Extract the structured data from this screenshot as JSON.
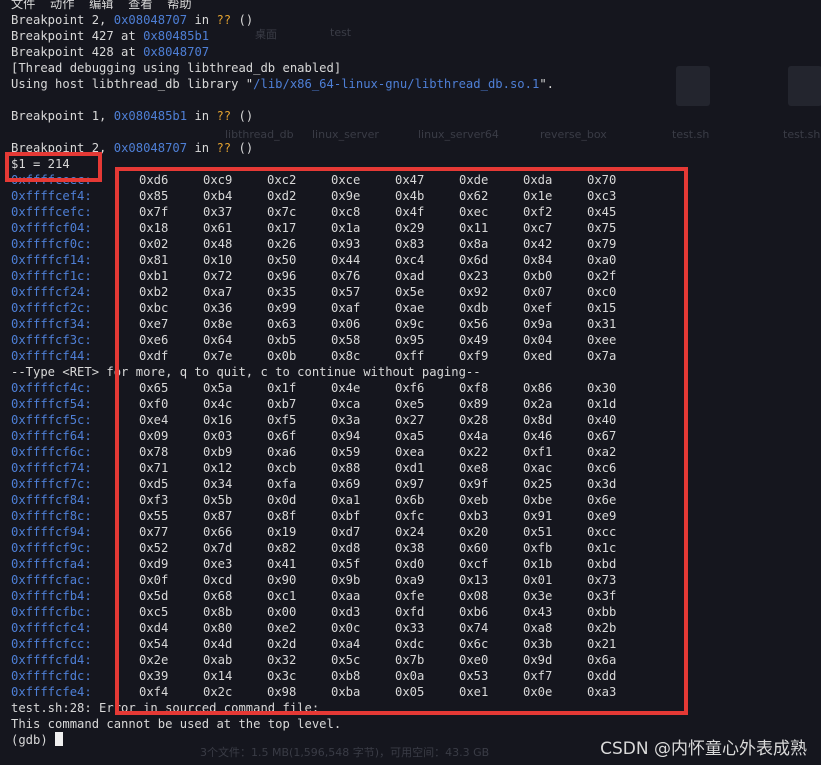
{
  "colors": {
    "background": "#15161e",
    "address": "#4e7fd6",
    "question": "#e0a030",
    "highlight_box": "#e53935"
  },
  "menu_fragment": "文件  动作  编辑  查看  帮助",
  "background_ghost": {
    "folders": [
      "linux_server",
      "linux_server64",
      "reverse_box",
      "test.sh",
      "test.sh"
    ],
    "labels": [
      "桌面",
      "test",
      "libthread_db"
    ],
    "status": "3个文件：1.5 MB(1,596,548 字节)，可用空间：43.3 GB"
  },
  "header_lines": [
    {
      "pre": "Breakpoint 2, ",
      "addr": "0x08048707",
      "mid": " in ",
      "q": "??",
      "post": " ()"
    },
    {
      "pre": "Breakpoint 427 at ",
      "addr": "0x80485b1",
      "mid": "",
      "q": "",
      "post": ""
    },
    {
      "pre": "Breakpoint 428 at ",
      "addr": "0x8048707",
      "mid": "",
      "q": "",
      "post": ""
    },
    {
      "pre": "[Thread debugging using libthread_db enabled]",
      "addr": "",
      "mid": "",
      "q": "",
      "post": ""
    },
    {
      "pre": "Using host libthread_db library \"",
      "addr": "/lib/x86_64-linux-gnu/libthread_db.so.1",
      "mid": "\".",
      "q": "",
      "post": ""
    },
    {
      "pre": "",
      "addr": "",
      "mid": "",
      "q": "",
      "post": ""
    },
    {
      "pre": "Breakpoint 1, ",
      "addr": "0x080485b1",
      "mid": " in ",
      "q": "??",
      "post": " ()"
    },
    {
      "pre": "",
      "addr": "",
      "mid": "",
      "q": "",
      "post": ""
    },
    {
      "pre": "Breakpoint 2, ",
      "addr": "0x08048707",
      "mid": " in ",
      "q": "??",
      "post": " ()"
    }
  ],
  "print_result": "$1 = 214",
  "mem_block1": [
    {
      "addr": "0xffffceec:",
      "bytes": [
        "0xd6",
        "0xc9",
        "0xc2",
        "0xce",
        "0x47",
        "0xde",
        "0xda",
        "0x70"
      ]
    },
    {
      "addr": "0xffffcef4:",
      "bytes": [
        "0x85",
        "0xb4",
        "0xd2",
        "0x9e",
        "0x4b",
        "0x62",
        "0x1e",
        "0xc3"
      ]
    },
    {
      "addr": "0xffffcefc:",
      "bytes": [
        "0x7f",
        "0x37",
        "0x7c",
        "0xc8",
        "0x4f",
        "0xec",
        "0xf2",
        "0x45"
      ]
    },
    {
      "addr": "0xffffcf04:",
      "bytes": [
        "0x18",
        "0x61",
        "0x17",
        "0x1a",
        "0x29",
        "0x11",
        "0xc7",
        "0x75"
      ]
    },
    {
      "addr": "0xffffcf0c:",
      "bytes": [
        "0x02",
        "0x48",
        "0x26",
        "0x93",
        "0x83",
        "0x8a",
        "0x42",
        "0x79"
      ]
    },
    {
      "addr": "0xffffcf14:",
      "bytes": [
        "0x81",
        "0x10",
        "0x50",
        "0x44",
        "0xc4",
        "0x6d",
        "0x84",
        "0xa0"
      ]
    },
    {
      "addr": "0xffffcf1c:",
      "bytes": [
        "0xb1",
        "0x72",
        "0x96",
        "0x76",
        "0xad",
        "0x23",
        "0xb0",
        "0x2f"
      ]
    },
    {
      "addr": "0xffffcf24:",
      "bytes": [
        "0xb2",
        "0xa7",
        "0x35",
        "0x57",
        "0x5e",
        "0x92",
        "0x07",
        "0xc0"
      ]
    },
    {
      "addr": "0xffffcf2c:",
      "bytes": [
        "0xbc",
        "0x36",
        "0x99",
        "0xaf",
        "0xae",
        "0xdb",
        "0xef",
        "0x15"
      ]
    },
    {
      "addr": "0xffffcf34:",
      "bytes": [
        "0xe7",
        "0x8e",
        "0x63",
        "0x06",
        "0x9c",
        "0x56",
        "0x9a",
        "0x31"
      ]
    },
    {
      "addr": "0xffffcf3c:",
      "bytes": [
        "0xe6",
        "0x64",
        "0xb5",
        "0x58",
        "0x95",
        "0x49",
        "0x04",
        "0xee"
      ]
    },
    {
      "addr": "0xffffcf44:",
      "bytes": [
        "0xdf",
        "0x7e",
        "0x0b",
        "0x8c",
        "0xff",
        "0xf9",
        "0xed",
        "0x7a"
      ]
    }
  ],
  "paging_prompt": "--Type <RET> for more, q to quit, c to continue without paging--",
  "mem_block2": [
    {
      "addr": "0xffffcf4c:",
      "bytes": [
        "0x65",
        "0x5a",
        "0x1f",
        "0x4e",
        "0xf6",
        "0xf8",
        "0x86",
        "0x30"
      ]
    },
    {
      "addr": "0xffffcf54:",
      "bytes": [
        "0xf0",
        "0x4c",
        "0xb7",
        "0xca",
        "0xe5",
        "0x89",
        "0x2a",
        "0x1d"
      ]
    },
    {
      "addr": "0xffffcf5c:",
      "bytes": [
        "0xe4",
        "0x16",
        "0xf5",
        "0x3a",
        "0x27",
        "0x28",
        "0x8d",
        "0x40"
      ]
    },
    {
      "addr": "0xffffcf64:",
      "bytes": [
        "0x09",
        "0x03",
        "0x6f",
        "0x94",
        "0xa5",
        "0x4a",
        "0x46",
        "0x67"
      ]
    },
    {
      "addr": "0xffffcf6c:",
      "bytes": [
        "0x78",
        "0xb9",
        "0xa6",
        "0x59",
        "0xea",
        "0x22",
        "0xf1",
        "0xa2"
      ]
    },
    {
      "addr": "0xffffcf74:",
      "bytes": [
        "0x71",
        "0x12",
        "0xcb",
        "0x88",
        "0xd1",
        "0xe8",
        "0xac",
        "0xc6"
      ]
    },
    {
      "addr": "0xffffcf7c:",
      "bytes": [
        "0xd5",
        "0x34",
        "0xfa",
        "0x69",
        "0x97",
        "0x9f",
        "0x25",
        "0x3d"
      ]
    },
    {
      "addr": "0xffffcf84:",
      "bytes": [
        "0xf3",
        "0x5b",
        "0x0d",
        "0xa1",
        "0x6b",
        "0xeb",
        "0xbe",
        "0x6e"
      ]
    },
    {
      "addr": "0xffffcf8c:",
      "bytes": [
        "0x55",
        "0x87",
        "0x8f",
        "0xbf",
        "0xfc",
        "0xb3",
        "0x91",
        "0xe9"
      ]
    },
    {
      "addr": "0xffffcf94:",
      "bytes": [
        "0x77",
        "0x66",
        "0x19",
        "0xd7",
        "0x24",
        "0x20",
        "0x51",
        "0xcc"
      ]
    },
    {
      "addr": "0xffffcf9c:",
      "bytes": [
        "0x52",
        "0x7d",
        "0x82",
        "0xd8",
        "0x38",
        "0x60",
        "0xfb",
        "0x1c"
      ]
    },
    {
      "addr": "0xffffcfa4:",
      "bytes": [
        "0xd9",
        "0xe3",
        "0x41",
        "0x5f",
        "0xd0",
        "0xcf",
        "0x1b",
        "0xbd"
      ]
    },
    {
      "addr": "0xffffcfac:",
      "bytes": [
        "0x0f",
        "0xcd",
        "0x90",
        "0x9b",
        "0xa9",
        "0x13",
        "0x01",
        "0x73"
      ]
    },
    {
      "addr": "0xffffcfb4:",
      "bytes": [
        "0x5d",
        "0x68",
        "0xc1",
        "0xaa",
        "0xfe",
        "0x08",
        "0x3e",
        "0x3f"
      ]
    },
    {
      "addr": "0xffffcfbc:",
      "bytes": [
        "0xc5",
        "0x8b",
        "0x00",
        "0xd3",
        "0xfd",
        "0xb6",
        "0x43",
        "0xbb"
      ]
    },
    {
      "addr": "0xffffcfc4:",
      "bytes": [
        "0xd4",
        "0x80",
        "0xe2",
        "0x0c",
        "0x33",
        "0x74",
        "0xa8",
        "0x2b"
      ]
    },
    {
      "addr": "0xffffcfcc:",
      "bytes": [
        "0x54",
        "0x4d",
        "0x2d",
        "0xa4",
        "0xdc",
        "0x6c",
        "0x3b",
        "0x21"
      ]
    },
    {
      "addr": "0xffffcfd4:",
      "bytes": [
        "0x2e",
        "0xab",
        "0x32",
        "0x5c",
        "0x7b",
        "0xe0",
        "0x9d",
        "0x6a"
      ]
    },
    {
      "addr": "0xffffcfdc:",
      "bytes": [
        "0x39",
        "0x14",
        "0x3c",
        "0xb8",
        "0x0a",
        "0x53",
        "0xf7",
        "0xdd"
      ]
    },
    {
      "addr": "0xffffcfe4:",
      "bytes": [
        "0xf4",
        "0x2c",
        "0x98",
        "0xba",
        "0x05",
        "0xe1",
        "0x0e",
        "0xa3"
      ]
    }
  ],
  "footer_lines": [
    "test.sh:28: Error in sourced command file:",
    "This command cannot be used at the top level."
  ],
  "prompt": "(gdb) ",
  "watermark": "CSDN @内怀童心外表成熟"
}
